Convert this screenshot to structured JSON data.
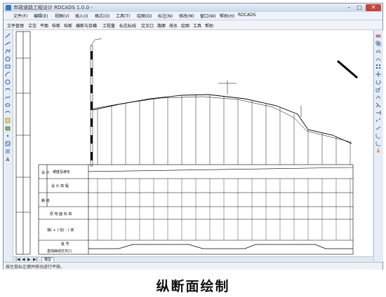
{
  "window": {
    "title": "市政道路工程设计 RDCADS 1.0.0 -",
    "minimize_glyph": "–",
    "maximize_glyph": "□",
    "close_glyph": "✕"
  },
  "menu": {
    "items": [
      "文件(F)",
      "编辑(E)",
      "视图(V)",
      "插入(I)",
      "格式(O)",
      "工具(T)",
      "绘图(D)",
      "标注(N)",
      "修改(M)",
      "窗口(W)",
      "帮助(H)",
      "RDCADS"
    ]
  },
  "toolbar": {
    "items": [
      "文件管理",
      "立交",
      "平面",
      "纵断",
      "纵断",
      "横断与拾横",
      "工程量",
      "标志标线",
      "交叉口",
      "路面",
      "排水",
      "绘图",
      "工具",
      "帮助"
    ]
  },
  "profile_table": {
    "row_labels": [
      "设 计 高 程",
      "原 地 面 标 高",
      "填( + ) 挖( - ) 高",
      "桩 号",
      "直线曲线交叉口"
    ],
    "left_header": [
      "坡度及坡长"
    ],
    "side_chars": [
      "设 计",
      "路 线"
    ]
  },
  "sheet_tabs": {
    "model_label": "模型",
    "nav_arrows": [
      "|◀",
      "◀",
      "▶",
      "▶|"
    ]
  },
  "status": {
    "text": "按住鼠标左键并移动进行平移。"
  },
  "caption": "纵断面绘制",
  "colors": {
    "accent": "#3a78c2",
    "close": "#c8443a"
  }
}
